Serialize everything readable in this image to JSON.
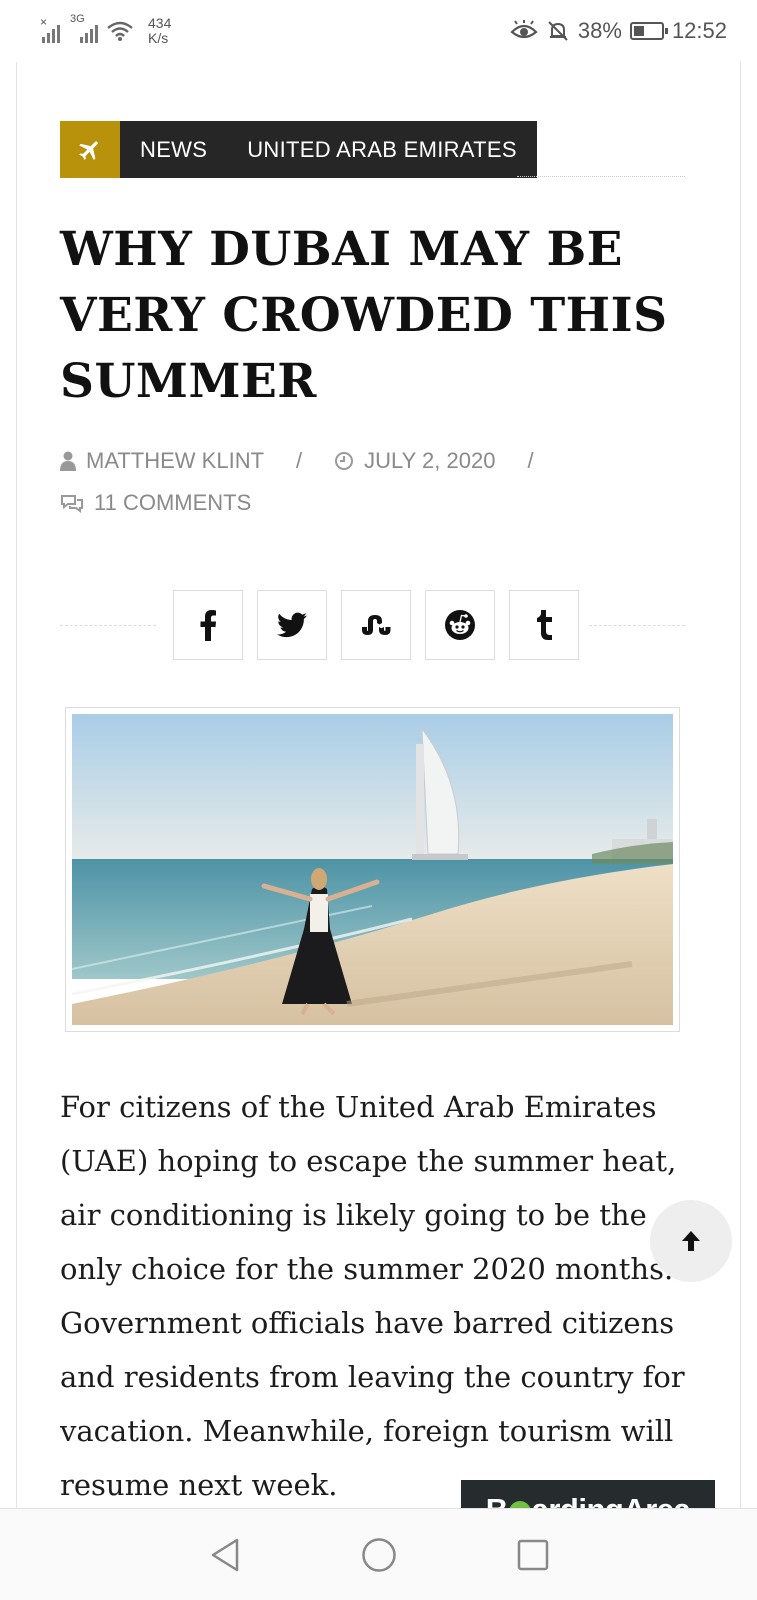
{
  "status_bar": {
    "net_speed_value": "434",
    "net_speed_unit": "K/s",
    "network_type": "3G",
    "battery_percent": "38%",
    "battery_level": 0.38,
    "time": "12:52"
  },
  "article": {
    "categories": [
      "NEWS",
      "UNITED ARAB EMIRATES"
    ],
    "title": "WHY DUBAI MAY BE VERY CROWDED THIS SUMMER",
    "author": "MATTHEW KLINT",
    "date": "JULY 2, 2020",
    "comments": "11 COMMENTS",
    "separator": "/",
    "share_buttons": [
      "facebook",
      "twitter",
      "stumbleupon",
      "reddit",
      "tumblr"
    ],
    "image_subject": "woman on beach with Burj Al Arab in background",
    "body": "For citizens of the United Arab Emirates (UAE) hoping to escape the summer heat, air conditioning is likely going to be the only choice for the summer 2020 months. Government officials have barred citizens and residents from leaving the country for vacation. Meanwhile, foreign tourism will resume next week."
  },
  "brand": {
    "name_prefix": "B",
    "name_suffix": "ardingArea",
    "accent_color": "#74c044"
  },
  "colors": {
    "category_icon_bg": "#b8920a",
    "category_bar_bg": "#262626"
  }
}
